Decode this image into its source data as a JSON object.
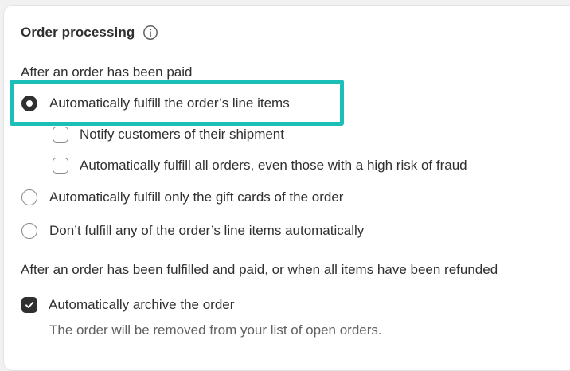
{
  "section": {
    "title": "Order processing",
    "paid_label": "After an order has been paid",
    "fulfill_options": [
      {
        "label": "Automatically fulfill the order’s line items",
        "selected": true
      },
      {
        "label": "Automatically fulfill only the gift cards of the order",
        "selected": false
      },
      {
        "label": "Don’t fulfill any of the order’s line items automatically",
        "selected": false
      }
    ],
    "sub_options": [
      {
        "label": "Notify customers of their shipment",
        "checked": false
      },
      {
        "label": "Automatically fulfill all orders, even those with a high risk of fraud",
        "checked": false
      }
    ],
    "fulfilled_label": "After an order has been fulfilled and paid, or when all items have been refunded",
    "archive": {
      "label": "Automatically archive the order",
      "checked": true,
      "help": "The order will be removed from your list of open orders."
    }
  },
  "colors": {
    "highlight": "#1bbfb7",
    "checked": "#303030"
  },
  "icons": {
    "title_icon": "info-icon",
    "checkbox_mark": "checkmark-icon"
  }
}
